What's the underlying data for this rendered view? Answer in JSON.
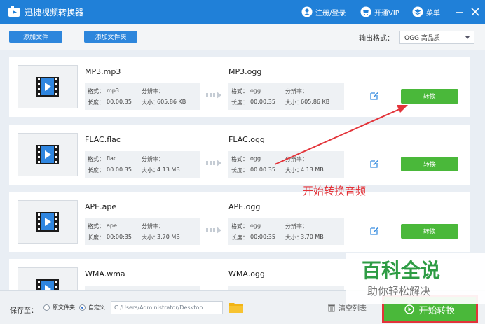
{
  "app": {
    "title": "迅捷视频转换器",
    "login": "注册/登录",
    "vip": "开通VIP",
    "menu": "菜单"
  },
  "toolbar": {
    "add_file": "添加文件",
    "add_folder": "添加文件夹",
    "output_format_label": "输出格式：",
    "output_format_value": "OGG  高品质"
  },
  "labels": {
    "format": "格式：",
    "resolution": "分辨率：",
    "duration": "长度：",
    "size": "大小：",
    "convert": "转换"
  },
  "files": [
    {
      "name": "MP3.mp3",
      "format": "mp3",
      "duration": "00:00:35",
      "size": "605.86 KB",
      "out_name": "MP3.ogg",
      "out_format": "ogg",
      "out_duration": "00:00:35",
      "out_size": "605.86 KB"
    },
    {
      "name": "FLAC.flac",
      "format": "flac",
      "duration": "00:00:35",
      "size": "4.13 MB",
      "out_name": "FLAC.ogg",
      "out_format": "ogg",
      "out_duration": "00:00:35",
      "out_size": "4.13 MB"
    },
    {
      "name": "APE.ape",
      "format": "ape",
      "duration": "00:00:35",
      "size": "3.70 MB",
      "out_name": "APE.ogg",
      "out_format": "ogg",
      "out_duration": "00:00:35",
      "out_size": "3.70 MB"
    },
    {
      "name": "WMA.wma",
      "format": "",
      "duration": "",
      "size": "",
      "out_name": "WMA.ogg",
      "out_format": "",
      "out_duration": "",
      "out_size": ""
    }
  ],
  "annotation": "开始转换音频",
  "bottom": {
    "save_to": "保存至：",
    "source_folder": "原文件夹",
    "custom": "自定义",
    "path": "C:/Users/Administrator/Desktop",
    "clear_list": "清空列表",
    "start": "开始转换"
  },
  "watermark": {
    "title": "百科全说",
    "subtitle": "助你轻松解决"
  },
  "colors": {
    "title_bar": "#2080d8",
    "accent_green": "#4ab83a",
    "annotation_red": "#e3343a"
  }
}
